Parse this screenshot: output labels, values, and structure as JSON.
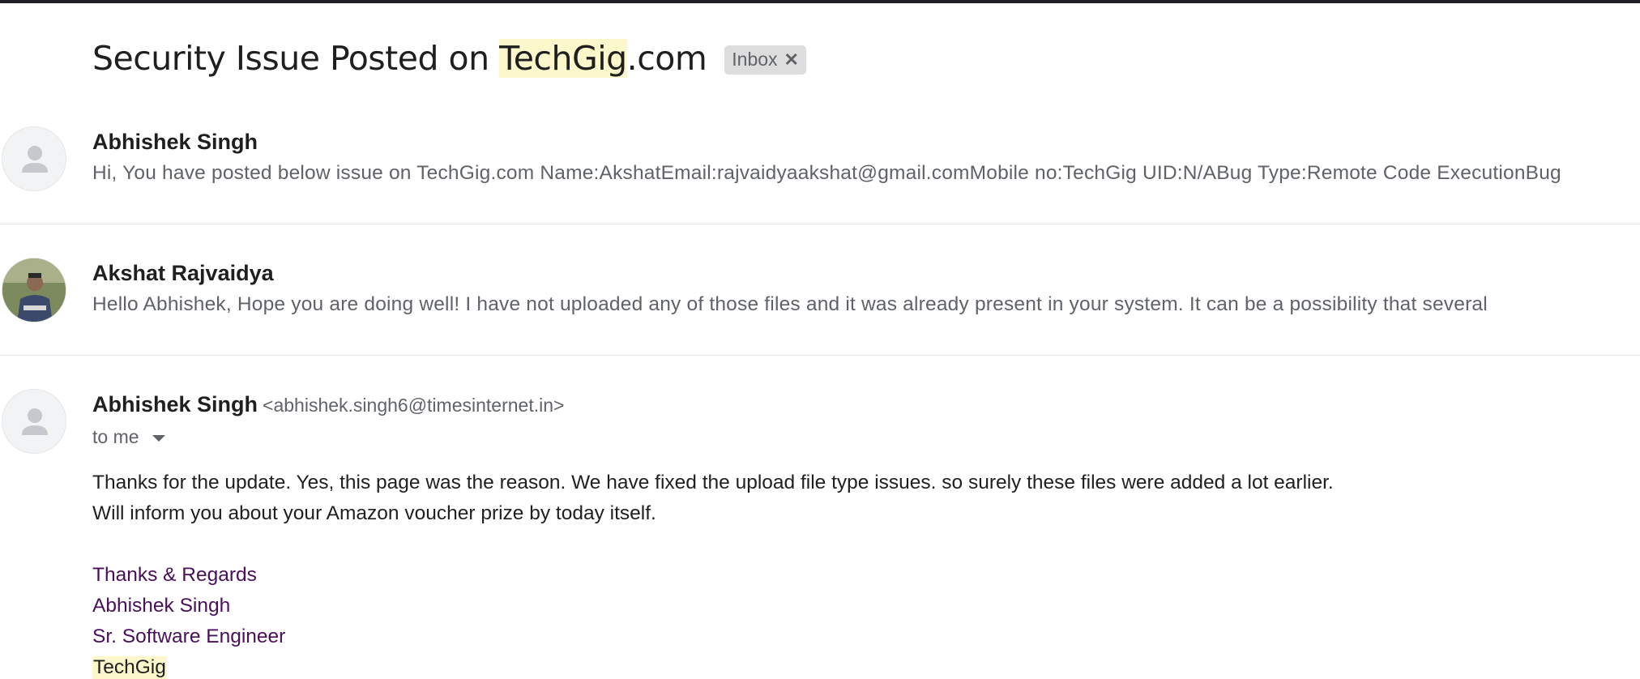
{
  "thread": {
    "subject_prefix": "Security Issue Posted on ",
    "subject_highlight": "TechGig",
    "subject_suffix": ".com",
    "label_chip": "Inbox",
    "label_remove_icon": "close-icon"
  },
  "messages": [
    {
      "sender": "Abhishek Singh",
      "snippet": "Hi, You have posted below issue on TechGig.com Name:AkshatEmail:rajvaidyaakshat@gmail.comMobile no:TechGig UID:N/ABug Type:Remote Code ExecutionBug",
      "avatar": "default-person-icon"
    },
    {
      "sender": "Akshat Rajvaidya",
      "snippet": "Hello Abhishek, Hope you are doing well! I have not uploaded any of those files and it was already present in your system. It can be a possibility that several",
      "avatar": "profile-photo"
    },
    {
      "sender": "Abhishek Singh",
      "sender_email": "<abhishek.singh6@timesinternet.in>",
      "recipient_line": "to me",
      "avatar": "default-person-icon",
      "body": [
        "Thanks for the update. Yes, this page was the reason. We have fixed the upload file type issues. so surely these files were added a lot earlier.",
        "Will inform you about your Amazon voucher prize by today itself."
      ],
      "signature": [
        "Thanks & Regards",
        "Abhishek Singh",
        "Sr. Software Engineer"
      ],
      "signature_company": "TechGig"
    }
  ],
  "colors": {
    "highlight": "#fdf8cc",
    "signature_text": "#4a0f5a",
    "snippet_text": "#5f6368",
    "chip_bg": "#dddddd"
  }
}
